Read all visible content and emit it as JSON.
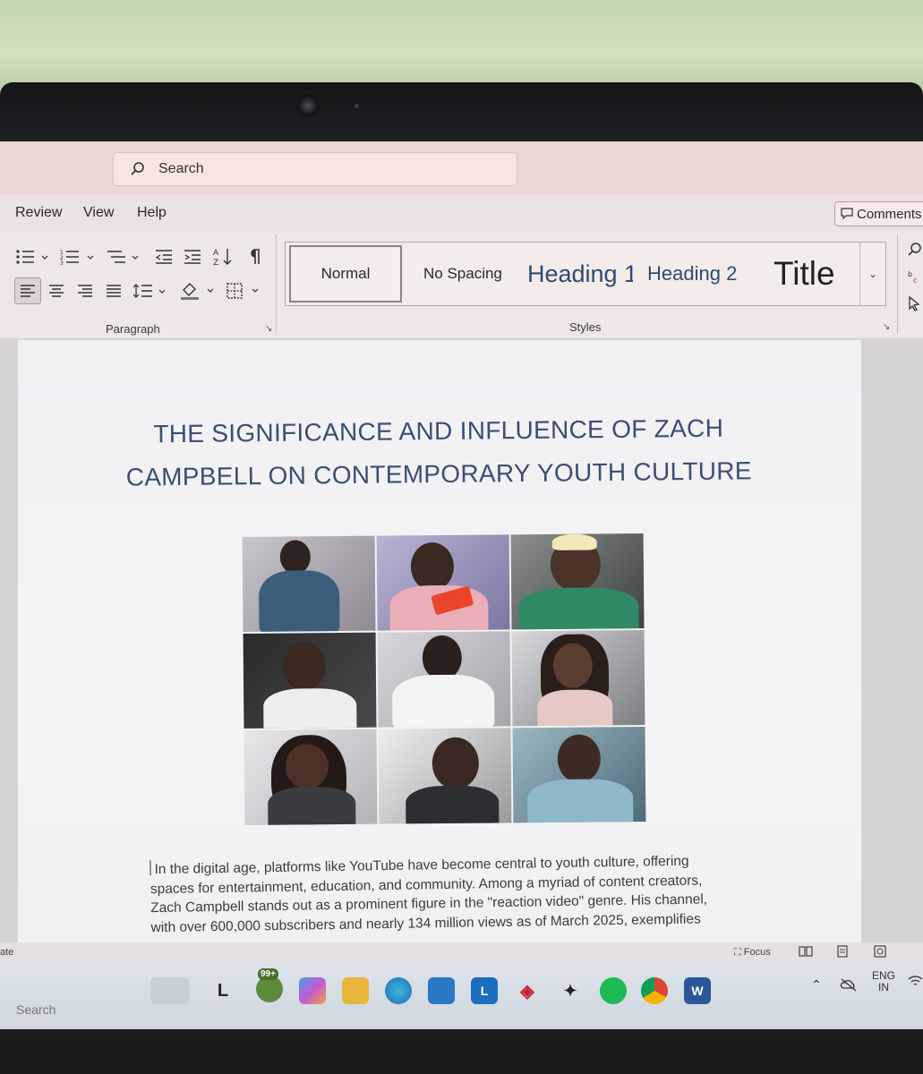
{
  "window": {
    "search_placeholder": "Search"
  },
  "menu": {
    "items": [
      "Review",
      "View",
      "Help"
    ],
    "comments_label": "Comments"
  },
  "ribbon": {
    "paragraph_label": "Paragraph",
    "styles_label": "Styles",
    "styles": [
      "Normal",
      "No Spacing",
      "Heading 1",
      "Heading 2",
      "Title"
    ]
  },
  "document": {
    "title_line1": "THE SIGNIFICANCE AND INFLUENCE OF ZACH",
    "title_line2": "CAMPBELL ON CONTEMPORARY YOUTH CULTURE",
    "body_lines": [
      "In the digital age, platforms like YouTube have become central to youth culture, offering",
      "spaces for entertainment, education, and community. Among a myriad of content creators,",
      "Zach Campbell stands out as a prominent figure in the \"reaction video\" genre. His channel,",
      "with over 600,000 subscribers and nearly 134 million views as of March 2025, exemplifies"
    ]
  },
  "statusbar": {
    "left_text": "ate",
    "focus_label": "Focus"
  },
  "taskbar": {
    "search_label": "Search",
    "badge_count": "99+",
    "app_letter": "L",
    "tray_lang_line1": "ENG",
    "tray_lang_line2": "IN"
  },
  "colors": {
    "title_blue": "#3b4f73",
    "heading_blue": "#2f4a73",
    "ribbon_bg": "#efe7e4",
    "page_bg": "#f3f2f4"
  }
}
